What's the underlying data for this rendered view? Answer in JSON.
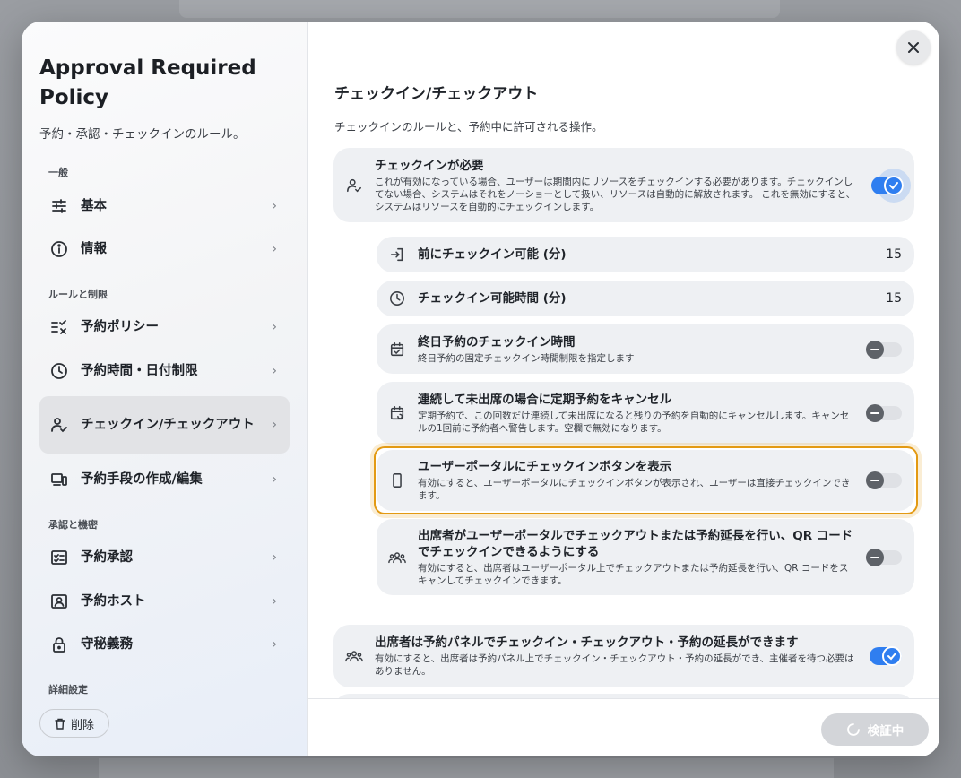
{
  "sidebar": {
    "title": "Approval Required Policy",
    "subtitle": "予約・承認・チェックインのルール。",
    "sections": {
      "general": "一般",
      "rules": "ルールと制限",
      "approval": "承認と機密",
      "advanced": "詳細設定"
    },
    "items": {
      "basic": "基本",
      "info": "情報",
      "reservation_policy": "予約ポリシー",
      "time_limits": "予約時間・日付制限",
      "checkin": "チェックイン/チェックアウト",
      "methods": "予約手段の作成/編集",
      "approval": "予約承認",
      "host": "予約ホスト",
      "confidential": "守秘義務"
    },
    "delete_label": "削除"
  },
  "main": {
    "title": "チェックイン/チェックアウト",
    "description": "チェックインのルールと、予約中に許可される操作。",
    "settings": {
      "checkin_required": {
        "title": "チェックインが必要",
        "desc": "これが有効になっている場合、ユーザーは期間内にリソースをチェックインする必要があります。チェックインしてない場合、システムはそれをノーショーとして扱い、リソースは自動的に解放されます。 これを無効にすると、システムはリソースを自動的にチェックインします。",
        "enabled": true
      },
      "checkin_before": {
        "title": "前にチェックイン可能 (分)",
        "value": "15"
      },
      "checkin_window": {
        "title": "チェックイン可能時間 (分)",
        "value": "15"
      },
      "allday_checkin": {
        "title": "終日予約のチェックイン時間",
        "desc": "終日予約の固定チェックイン時間制限を指定します",
        "enabled": false
      },
      "cancel_recurring": {
        "title": "連続して未出席の場合に定期予約をキャンセル",
        "desc": "定期予約で、この回数だけ連続して未出席になると残りの予約を自動的にキャンセルします。キャンセルの1回前に予約者へ警告します。空欄で無効になります。",
        "enabled": false
      },
      "portal_checkin_button": {
        "title": "ユーザーポータルにチェックインボタンを表示",
        "desc": "有効にすると、ユーザーポータルにチェックインボタンが表示され、ユーザーは直接チェックインできます。",
        "enabled": false
      },
      "attendee_portal": {
        "title": "出席者がユーザーポータルでチェックアウトまたは予約延長を行い、QR コードでチェックインできるようにする",
        "desc": "有効にすると、出席者はユーザーポータル上でチェックアウトまたは予約延長を行い、QR コードをスキャンしてチェックインできます。",
        "enabled": false
      },
      "attendee_panel": {
        "title": "出席者は予約パネルでチェックイン・チェックアウト・予約の延長ができます",
        "desc": "有効にすると、出席者は予約パネル上でチェックイン・チェックアウト・予約の延長ができ、主催者を待つ必要はありません。",
        "enabled": true
      }
    },
    "verify_label": "検証中"
  },
  "colors": {
    "accent": "#2f7ef0",
    "focus": "#e39a13"
  }
}
